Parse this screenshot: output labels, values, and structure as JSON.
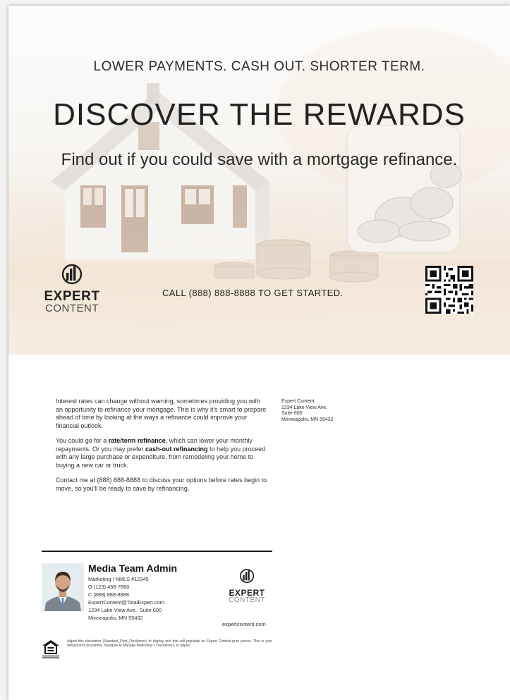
{
  "hero": {
    "tagline": "LOWER PAYMENTS. CASH OUT. SHORTER TERM.",
    "headline": "DISCOVER THE REWARDS",
    "subheadline": "Find out if you could save with a mortgage refinance.",
    "cta": "CALL (888) 888-8888 TO GET STARTED."
  },
  "brand": {
    "wordmark_top": "EXPERT",
    "wordmark_bottom": "CONTENT"
  },
  "body": {
    "p1": "Interest rates can change without warning, sometimes providing you with an opportunity to refinance your mortgage. This is why it's smart to prepare ahead of time by looking at the ways a refinance could improve your financial outlook.",
    "p2_before": "You could go for a ",
    "p2_bold1": "rate/term refinance",
    "p2_middle": ", which can lower your monthly repayments. Or you may prefer ",
    "p2_bold2": "cash-out refinancing",
    "p2_after": " to help you proceed with any large purchase or expenditure, from remodeling your home to buying a new car or truck.",
    "p3": "Contact me at (888) 888-8888 to discuss your options before rates begin to move, so you'll be ready to save by refinancing."
  },
  "address": {
    "line1": "Expert Content",
    "line2": "1234 Lake View Ave.",
    "line3": "Suite 600",
    "line4": "Minneapolis, MN 55432"
  },
  "agent": {
    "name": "Media Team Admin",
    "title": "Marketing | NMLS #12345",
    "office": "O (123) 456-7890",
    "cell": "C (888) 888-8888",
    "email": "ExpertContent@TotalExpert.com",
    "address1": "1234 Lake View Ave., Suite 600",
    "address2": "Minneapolis, MN 55432",
    "website": "expertcontent.com"
  },
  "disclaimer": "Adjust this disclaimer (Standard_Print_Disclaimer) to display text that will populate on Expert Content print pieces. This is your default print disclaimer. Navigate to Manage Marketing > Disclaimers, to adjust.",
  "icons": {
    "logo": "expert-content-logo-icon",
    "qr": "qr-code-icon",
    "housing": "equal-housing-opportunity-icon"
  },
  "colors": {
    "text": "#1c1c1c",
    "rule": "#1a1a1a",
    "logo_accent": "#7f8f95"
  }
}
